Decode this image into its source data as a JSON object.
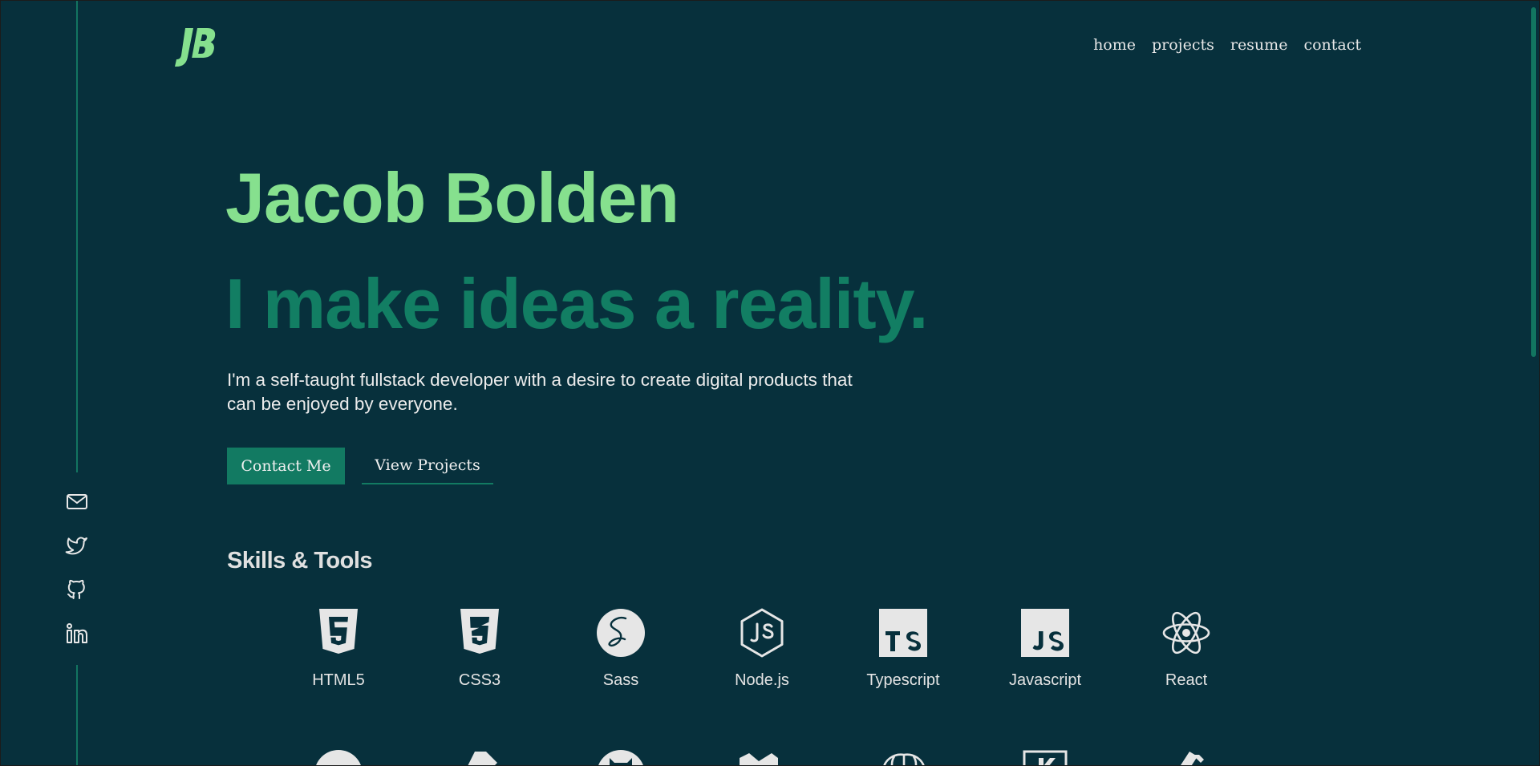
{
  "logo": {
    "text": "JB",
    "color": "#86e08e"
  },
  "nav": {
    "items": [
      {
        "label": "home"
      },
      {
        "label": "projects"
      },
      {
        "label": "resume"
      },
      {
        "label": "contact"
      }
    ]
  },
  "social": [
    {
      "icon": "mail-icon"
    },
    {
      "icon": "twitter-icon"
    },
    {
      "icon": "github-icon"
    },
    {
      "icon": "linkedin-icon"
    }
  ],
  "hero": {
    "name": "Jacob Bolden",
    "tagline": "I make ideas a reality.",
    "intro": "I'm a self-taught fullstack developer with a desire to create digital products that can be enjoyed by everyone.",
    "primary_button": "Contact Me",
    "secondary_button": "View Projects"
  },
  "skills": {
    "heading": "Skills & Tools",
    "items": [
      {
        "label": "HTML5",
        "icon": "html5-icon"
      },
      {
        "label": "CSS3",
        "icon": "css3-icon"
      },
      {
        "label": "Sass",
        "icon": "sass-icon"
      },
      {
        "label": "Node.js",
        "icon": "nodejs-icon"
      },
      {
        "label": "Typescript",
        "icon": "typescript-icon"
      },
      {
        "label": "Javascript",
        "icon": "javascript-icon"
      },
      {
        "label": "React",
        "icon": "react-icon"
      }
    ]
  },
  "colors": {
    "background": "#07303c",
    "accent_light": "#86e08e",
    "accent_dark": "#127e63",
    "text": "#e6e6e6"
  }
}
